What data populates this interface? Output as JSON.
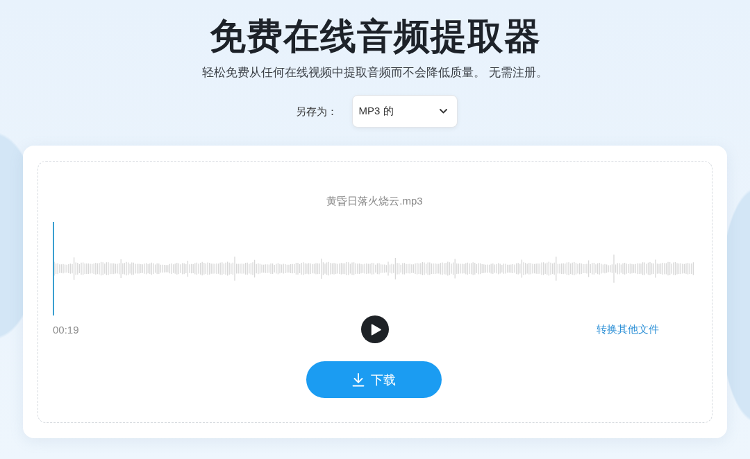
{
  "header": {
    "title": "免费在线音频提取器",
    "subtitle": "轻松免费从任何在线视频中提取音频而不会降低质量。 无需注册。"
  },
  "save_as": {
    "label": "另存为：",
    "value": "MP3 的"
  },
  "player": {
    "file_name": "黄昏日落火烧云.mp3",
    "level": 0,
    "time": "00:19",
    "playing": false,
    "convert_link": "转换其他文件",
    "download_button": "下载"
  }
}
